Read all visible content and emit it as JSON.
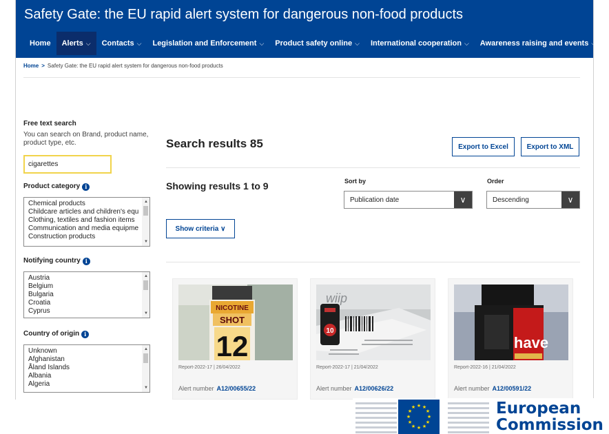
{
  "header": {
    "title": "Safety Gate: the EU rapid alert system for dangerous non-food products",
    "nav": [
      {
        "label": "Home",
        "chevron": false,
        "active": false
      },
      {
        "label": "Alerts",
        "chevron": true,
        "active": true
      },
      {
        "label": "Contacts",
        "chevron": true,
        "active": false
      },
      {
        "label": "Legislation and Enforcement",
        "chevron": true,
        "active": false
      },
      {
        "label": "Product safety online",
        "chevron": true,
        "active": false
      },
      {
        "label": "International cooperation",
        "chevron": true,
        "active": false
      },
      {
        "label": "Awareness raising and events",
        "chevron": true,
        "active": false
      }
    ],
    "chevron_glyph": "⌵"
  },
  "breadcrumb": {
    "home": "Home",
    "separator": ">",
    "current": "Safety Gate: the EU rapid alert system for dangerous non-food products"
  },
  "sidebar": {
    "free_text": {
      "heading": "Free text search",
      "help": "You can search on Brand, product name, product type, etc.",
      "value": "cigarettes"
    },
    "product_category": {
      "heading": "Product category",
      "options": [
        "Chemical products",
        "Childcare articles and children's equ",
        "Clothing, textiles and fashion items",
        "Communication and media equipme",
        "Construction products"
      ]
    },
    "notifying_country": {
      "heading": "Notifying country",
      "options": [
        "Austria",
        "Belgium",
        "Bulgaria",
        "Croatia",
        "Cyprus"
      ]
    },
    "country_of_origin": {
      "heading": "Country of origin",
      "options": [
        "Unknown",
        "Afghanistan",
        "Åland Islands",
        "Albania",
        "Algeria"
      ]
    },
    "info_glyph": "i"
  },
  "results": {
    "title": "Search results 85",
    "showing": "Showing results 1 to 9",
    "export_excel": "Export to Excel",
    "export_xml": "Export to XML",
    "show_criteria": "Show criteria",
    "show_criteria_chevron": "∨",
    "sort_label": "Sort by",
    "sort_value": "Publication date",
    "order_label": "Order",
    "order_value": "Descending",
    "select_arrow": "∨",
    "cards": [
      {
        "meta": "Report-2022-17 | 26/04/2022",
        "alert_label": "Alert number",
        "alert_number": "A12/00655/22",
        "image_text": [
          "NICOTINE",
          "SHOT",
          "12"
        ]
      },
      {
        "meta": "Report-2022-17 | 21/04/2022",
        "alert_label": "Alert number",
        "alert_number": "A12/00626/22",
        "image_text": [
          "wiip",
          "10"
        ]
      },
      {
        "meta": "Report-2022-16 | 21/04/2022",
        "alert_label": "Alert number",
        "alert_number": "A12/00591/22",
        "image_text": [
          "have"
        ]
      }
    ]
  },
  "footer_logo": {
    "line1": "European",
    "line2": "Commission",
    "flag_color": "#004494",
    "star_color": "#ffdd00"
  },
  "colors": {
    "brand_blue": "#004494",
    "nav_active": "#0b2d6b",
    "search_focus": "#f1d34a"
  }
}
